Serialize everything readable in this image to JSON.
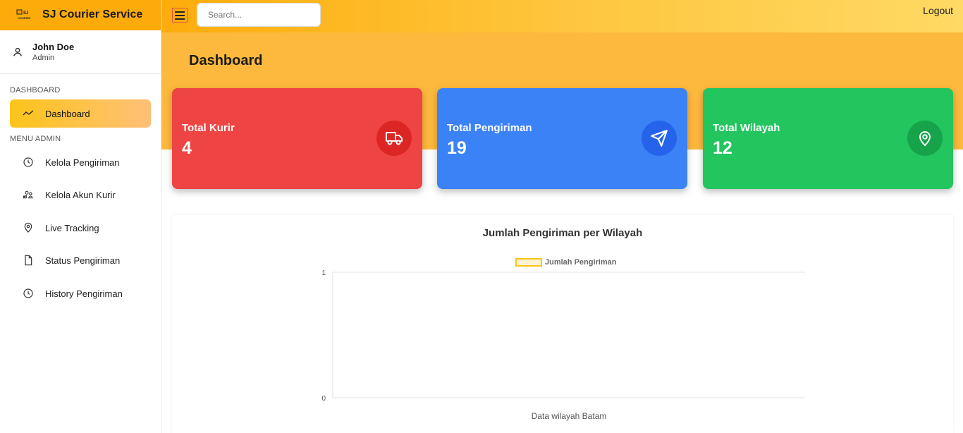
{
  "brand": {
    "logo_text": "SJ COURIER",
    "title": "SJ Courier Service"
  },
  "user": {
    "name": "John Doe",
    "role": "Admin",
    "icon": "user-icon"
  },
  "sidebar": {
    "section_dashboard": "DASHBOARD",
    "section_admin": "MENU ADMIN",
    "active": {
      "label": "Dashboard",
      "icon": "trend-icon"
    },
    "items": [
      {
        "label": "Kelola Pengiriman",
        "icon": "clock-icon"
      },
      {
        "label": "Kelola Akun Kurir",
        "icon": "users-icon"
      },
      {
        "label": "Live Tracking",
        "icon": "map-pin-icon"
      },
      {
        "label": "Status Pengiriman",
        "icon": "file-icon"
      },
      {
        "label": "History Pengiriman",
        "icon": "clock-icon"
      }
    ]
  },
  "topbar": {
    "search_placeholder": "Search...",
    "logout": "Logout"
  },
  "main": {
    "title": "Dashboard",
    "cards": [
      {
        "title": "Total Kurir",
        "value": "4",
        "icon": "truck-icon",
        "color": "#ef4444",
        "icon_bg": "#dc2626"
      },
      {
        "title": "Total Pengiriman",
        "value": "19",
        "icon": "send-icon",
        "color": "#3b82f6",
        "icon_bg": "#2563eb"
      },
      {
        "title": "Total Wilayah",
        "value": "12",
        "icon": "map-pin-icon",
        "color": "#22c55e",
        "icon_bg": "#16a34a"
      }
    ],
    "chart_title": "Jumlah Pengiriman per Wilayah"
  },
  "chart_data": {
    "type": "bar",
    "title": "Jumlah Pengiriman per Wilayah",
    "categories": [
      "Data wilayah Batam"
    ],
    "series": [
      {
        "name": "Jumlah Pengiriman",
        "values": [
          0
        ]
      }
    ],
    "ylim": [
      0,
      1
    ],
    "yticks": [
      "0",
      "1"
    ],
    "grid": true,
    "legend": "top",
    "series_color": "#fcc419"
  }
}
